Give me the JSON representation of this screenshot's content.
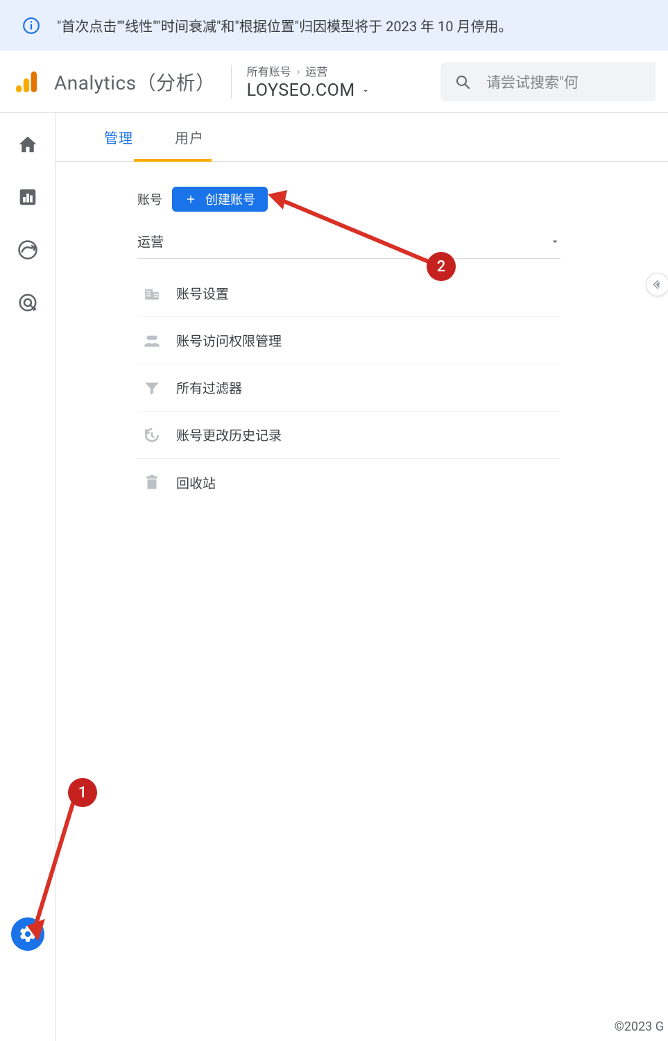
{
  "notice": {
    "text": "\"首次点击\"\"线性\"\"时间衰减\"和\"根据位置\"归因模型将于 2023 年 10 月停用。"
  },
  "header": {
    "product_name": "Analytics（分析）",
    "breadcrumb_root": "所有账号",
    "breadcrumb_current": "运营",
    "property_name": "LOYSEO.COM",
    "search_placeholder": "请尝试搜索\"何"
  },
  "tabs": {
    "admin": "管理",
    "users": "用户",
    "active": "admin"
  },
  "panel": {
    "account_label": "账号",
    "create_account_label": "创建账号",
    "selected_account": "运营",
    "menu_items": [
      {
        "icon": "building-icon",
        "label": "账号设置"
      },
      {
        "icon": "people-icon",
        "label": "账号访问权限管理"
      },
      {
        "icon": "filter-icon",
        "label": "所有过滤器"
      },
      {
        "icon": "history-icon",
        "label": "账号更改历史记录"
      },
      {
        "icon": "trash-icon",
        "label": "回收站"
      }
    ]
  },
  "annotations": {
    "badge1": "1",
    "badge2": "2"
  },
  "footer": {
    "copyright": "©2023 G"
  }
}
